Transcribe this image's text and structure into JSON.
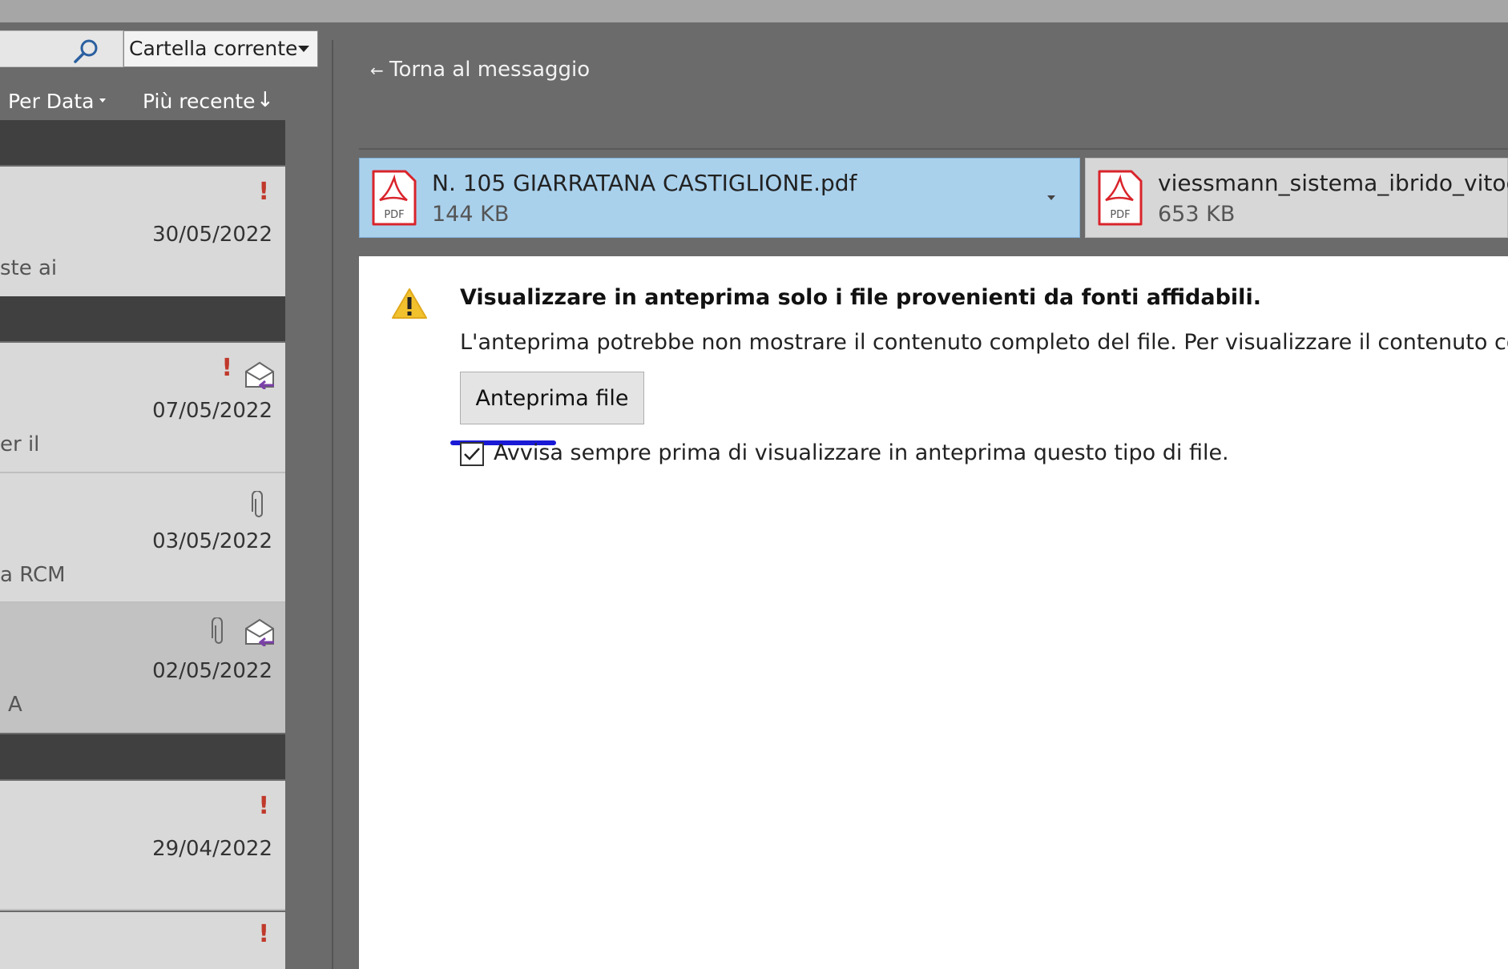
{
  "search": {
    "scope": "Cartella corrente"
  },
  "sort": {
    "field": "Per Data",
    "order": "Più recente"
  },
  "messages": [
    {
      "date": "30/05/2022",
      "snippet": "ste ai"
    },
    {
      "date": "07/05/2022",
      "snippet": "er il"
    },
    {
      "date": "03/05/2022",
      "snippet": "a RCM"
    },
    {
      "date": "02/05/2022",
      "snippet": "A"
    },
    {
      "date": "29/04/2022",
      "snippet": ""
    }
  ],
  "importance_mark": "!",
  "back_link": "Torna al messaggio",
  "attachments": [
    {
      "name": "N. 105 GIARRATANA CASTIGLIONE.pdf",
      "size": "144 KB",
      "icon": "pdf-icon"
    },
    {
      "name": "viessmann_sistema_ibrido_vitocal",
      "size": "653 KB",
      "icon": "pdf-icon"
    }
  ],
  "pdf_label": "PDF",
  "warning": {
    "title": "Visualizzare in anteprima solo i file provenienti da fonti affidabili.",
    "body": "L'anteprima potrebbe non mostrare il contenuto completo del file. Per visualizzare il contenuto com",
    "button": "Anteprima file",
    "checkbox_label": "Avvisa sempre prima di visualizzare in anteprima questo tipo di file.",
    "checkbox_checked": true
  },
  "colors": {
    "selected_attachment": "#aad1ec",
    "pdf_red": "#d9242b",
    "importance_red": "#c0392b",
    "warning_yellow": "#f2c12e",
    "annotation_blue": "#1a1ad6"
  }
}
